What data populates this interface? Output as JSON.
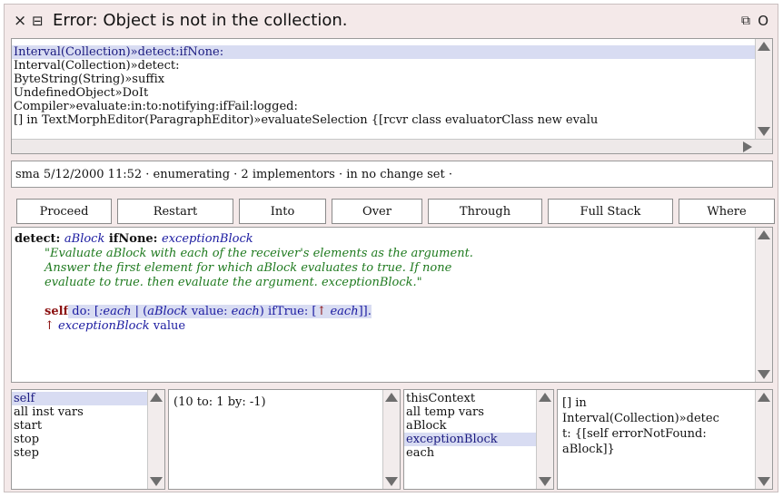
{
  "window": {
    "title": "Error: Object is not in the collection.",
    "close_glyph": "×",
    "menu_glyph": "⊟",
    "collapse_glyph": "⧉",
    "expand_glyph": "O"
  },
  "stack": {
    "frames": [
      "Interval(Collection)»detect:ifNone:",
      "Interval(Collection)»detect:",
      "ByteString(String)»suffix",
      "UndefinedObject»DoIt",
      "Compiler»evaluate:in:to:notifying:ifFail:logged:",
      "[] in TextMorphEditor(ParagraphEditor)»evaluateSelection {[rcvr class evaluatorClass new    evalu"
    ],
    "selected_index": 0
  },
  "info_bar": "sma 5/12/2000 11:52 · enumerating · 2 implementors · in no change set ·",
  "buttons": {
    "proceed": "Proceed",
    "restart": "Restart",
    "into": "Into",
    "over": "Over",
    "through": "Through",
    "full_stack": "Full Stack",
    "where": "Where"
  },
  "source": {
    "l1_sel1": "detect: ",
    "l1_arg1": "aBlock",
    "l1_sel2": " ifNone: ",
    "l1_arg2": "exceptionBlock",
    "comment1": "\"Evaluate aBlock with each of the receiver's elements as the argument.",
    "comment2": "Answer the first element for which aBlock evaluates to true. If none",
    "comment3": "evaluate to true. then evaluate the argument. exceptionBlock.\"",
    "s_self": "self",
    "s_do": " do: [",
    "s_each_param": ":each",
    "s_bar": " | (",
    "s_ablock": "aBlock",
    "s_value": " value: ",
    "s_each": "each",
    "s_iftrue": ") ifTrue: [",
    "s_caret": "↑ ",
    "s_each2": "each",
    "s_close": "]].",
    "r_caret": "↑ ",
    "r_exc": "exceptionBlock",
    "r_value": " value"
  },
  "receiver_fields": {
    "items": [
      "self",
      "all inst vars",
      "start",
      "stop",
      "step"
    ],
    "selected_index": 0,
    "value": "(10 to: 1 by: -1)"
  },
  "context_fields": {
    "items": [
      "thisContext",
      "all temp vars",
      "aBlock",
      "exceptionBlock",
      "each"
    ],
    "selected_index": 3,
    "value_lines": [
      "[] in",
      "Interval(Collection)»detec",
      "t: {[self errorNotFound:",
      "aBlock]}"
    ]
  }
}
